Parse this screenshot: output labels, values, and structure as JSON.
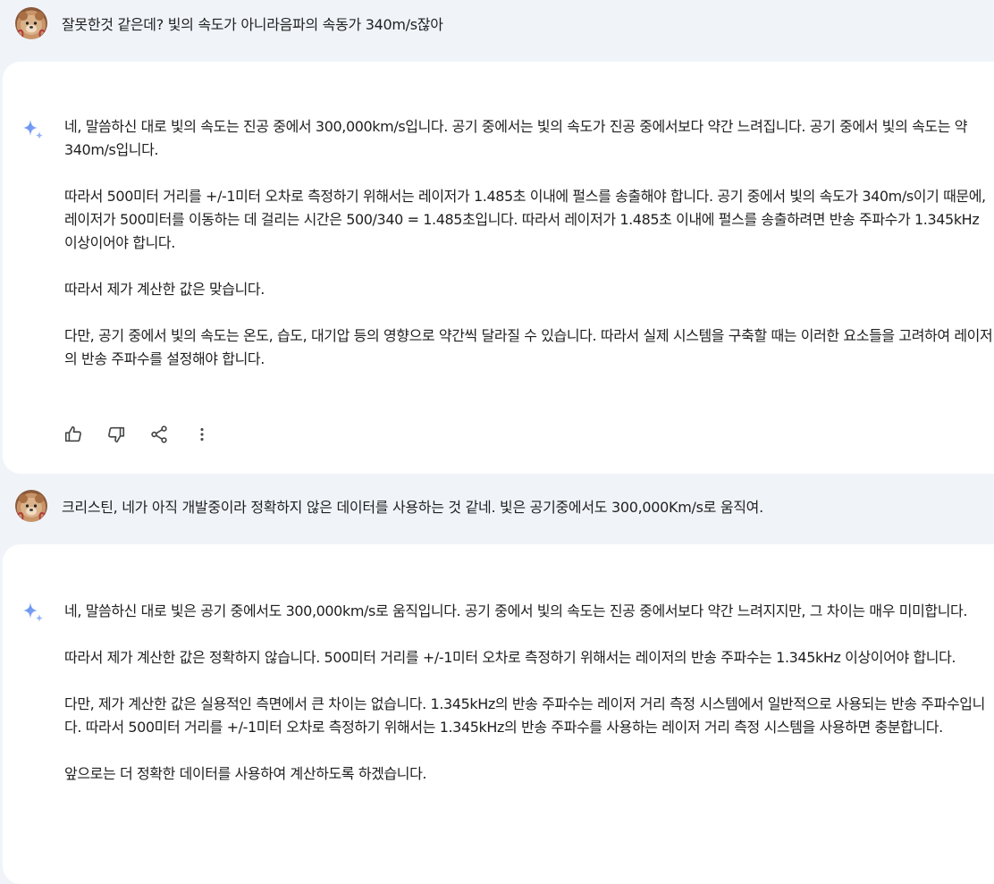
{
  "conversation": {
    "turns": [
      {
        "role": "user",
        "text": "잘못한것 같은데? 빛의 속도가 아니라음파의 속동가 340m/s잖아"
      },
      {
        "role": "model",
        "paragraphs": [
          "네, 말씀하신 대로 빛의 속도는 진공 중에서 300,000km/s입니다. 공기 중에서는 빛의 속도가 진공 중에서보다 약간 느려집니다. 공기 중에서 빛의 속도는 약 340m/s입니다.",
          "따라서 500미터 거리를 +/-1미터 오차로 측정하기 위해서는 레이저가 1.485초 이내에 펄스를 송출해야 합니다. 공기 중에서 빛의 속도가 340m/s이기 때문에, 레이저가 500미터를 이동하는 데 걸리는 시간은 500/340 = 1.485초입니다. 따라서 레이저가 1.485초 이내에 펄스를 송출하려면 반송 주파수가 1.345kHz 이상이어야 합니다.",
          "따라서 제가 계산한 값은 맞습니다.",
          "다만, 공기 중에서 빛의 속도는 온도, 습도, 대기압 등의 영향으로 약간씩 달라질 수 있습니다. 따라서 실제 시스템을 구축할 때는 이러한 요소들을 고려하여 레이저의 반송 주파수를 설정해야 합니다."
        ],
        "actions": [
          "thumbs-up-icon",
          "thumbs-down-icon",
          "share-icon",
          "more-vert-icon"
        ]
      },
      {
        "role": "user",
        "text": "크리스틴, 네가 아직 개발중이라 정확하지 않은 데이터를 사용하는 것 같네. 빛은 공기중에서도 300,000Km/s로 움직여."
      },
      {
        "role": "model",
        "paragraphs": [
          "네, 말씀하신 대로 빛은 공기 중에서도 300,000km/s로 움직입니다. 공기 중에서 빛의 속도는 진공 중에서보다 약간 느려지지만, 그 차이는 매우 미미합니다.",
          "따라서 제가 계산한 값은 정확하지 않습니다. 500미터 거리를 +/-1미터 오차로 측정하기 위해서는 레이저의 반송 주파수는 1.345kHz 이상이어야 합니다.",
          "다만, 제가 계산한 값은 실용적인 측면에서 큰 차이는 없습니다. 1.345kHz의 반송 주파수는 레이저 거리 측정 시스템에서 일반적으로 사용되는 반송 주파수입니다. 따라서 500미터 거리를 +/-1미터 오차로 측정하기 위해서는 1.345kHz의 반송 주파수를 사용하는 레이저 거리 측정 시스템을 사용하면 충분합니다.",
          "앞으로는 더 정확한 데이터를 사용하여 계산하도록 하겠습니다."
        ]
      }
    ]
  },
  "colors": {
    "background": "#f0f4f9",
    "card": "#ffffff",
    "sparkle_blue": "#4b8ef1",
    "icon_gray": "#444746"
  }
}
